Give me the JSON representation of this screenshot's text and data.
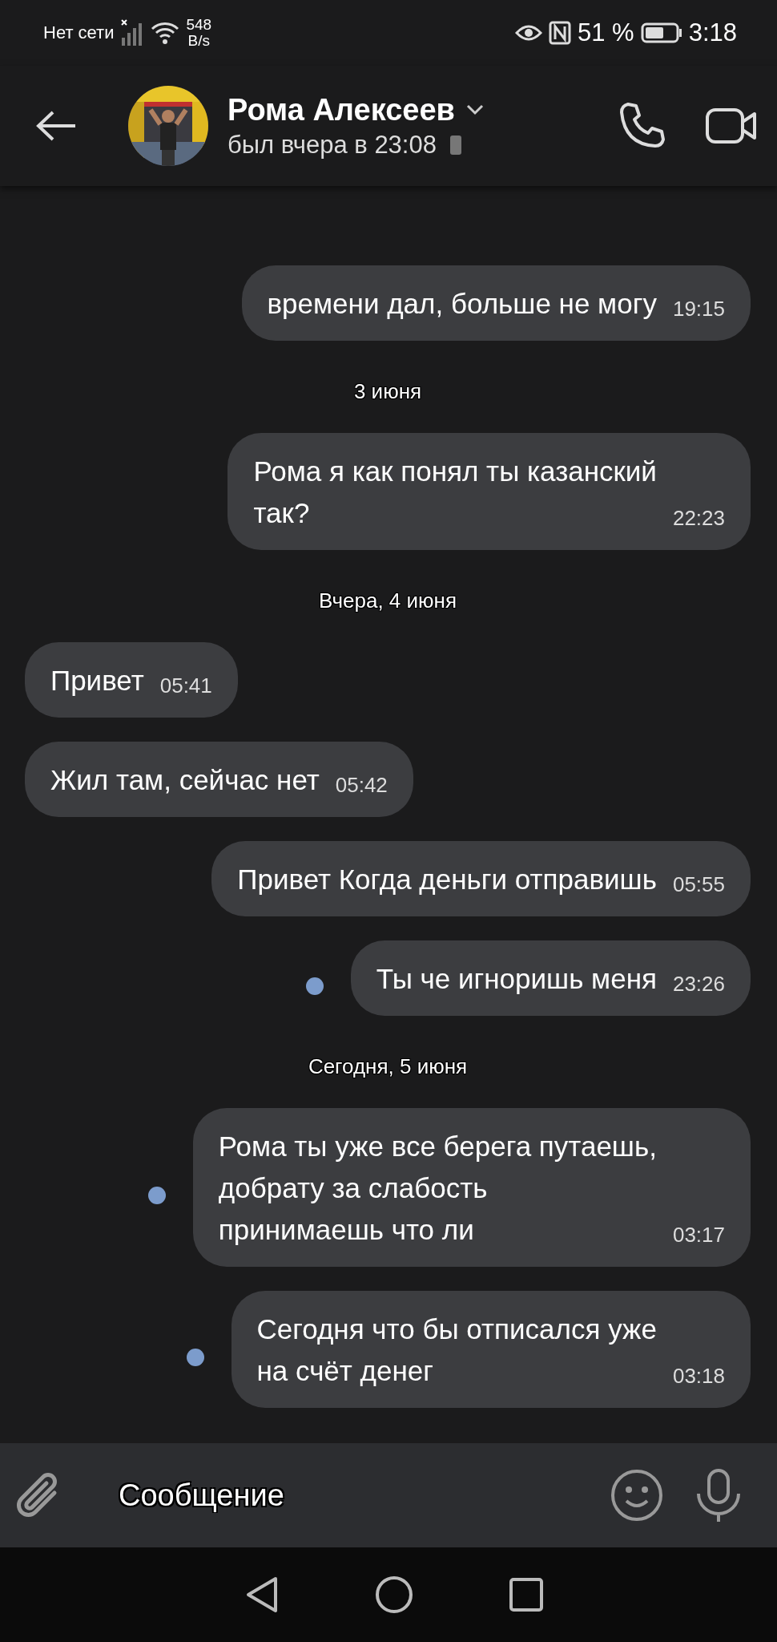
{
  "status_bar": {
    "carrier": "Нет сети",
    "speed": "548",
    "speed_unit": "B/s",
    "battery": "51 %",
    "time": "3:18"
  },
  "header": {
    "name": "Рома Алексеев",
    "last_seen": "был вчера в 23:08"
  },
  "messages": [
    {
      "kind": "out",
      "text": "времени дал, больше не могу",
      "time": "19:15",
      "unread": false
    },
    {
      "kind": "date",
      "text": "3 июня"
    },
    {
      "kind": "out",
      "text": "Рома я как понял ты казанский\nтак?",
      "time": "22:23",
      "unread": false
    },
    {
      "kind": "date",
      "text": "Вчера, 4 июня"
    },
    {
      "kind": "in",
      "text": "Привет",
      "time": "05:41",
      "unread": false
    },
    {
      "kind": "in",
      "text": "Жил там, сейчас нет",
      "time": "05:42",
      "unread": false
    },
    {
      "kind": "out",
      "text": "Привет Когда деньги отправишь",
      "time": "05:55",
      "unread": false
    },
    {
      "kind": "out",
      "text": "Ты че игноришь меня",
      "time": "23:26",
      "unread": true
    },
    {
      "kind": "date",
      "text": "Сегодня, 5 июня"
    },
    {
      "kind": "out",
      "text": "Рома ты уже все берега путаешь,\nдобрату за слабость\nпринимаешь что ли",
      "time": "03:17",
      "unread": true
    },
    {
      "kind": "out",
      "text": "Сегодня что бы отписался уже\nна счёт денег",
      "time": "03:18",
      "unread": true
    }
  ],
  "composer": {
    "placeholder": "Сообщение"
  }
}
